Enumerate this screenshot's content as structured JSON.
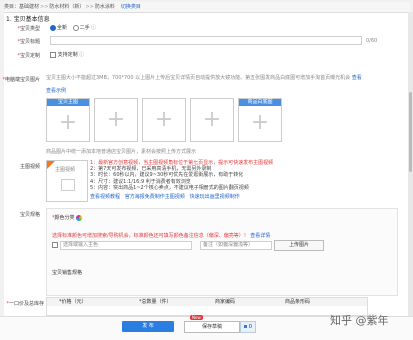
{
  "category": {
    "prefix": "类目：",
    "levels": [
      "基础建材",
      "防水材料（新）",
      "防水涂料"
    ],
    "switch_label": "切换类目"
  },
  "section_title": "1. 宝贝基本信息",
  "type_row": {
    "label": "宝贝类型",
    "options": [
      "全新",
      "二手"
    ],
    "selected": 0
  },
  "title_row": {
    "label": "宝贝标题",
    "counter": "0/60"
  },
  "custom_row": {
    "label": "宝贝定制",
    "option": "支持定制"
  },
  "main_image": {
    "label": "电脑端宝贝图片",
    "hint": "宝贝主图大小不能超过3MB；700*700 以上图片上传后宝贝详情页自动提供放大镜功能。第五张图发商品白底图可增加手淘首页曝光机会",
    "hint_link": "查看",
    "example_link": "查看示例",
    "box_labels": [
      "宝贝主图",
      "",
      "",
      "",
      "商品白底图"
    ],
    "footer_hint": "商品图片中统一添加本地普通店宝贝图片，素材会按照上传方式展示"
  },
  "video": {
    "label": "主图视频",
    "thumb_label": "主图视频",
    "tips": [
      "1：最新官方创意视频，当主图视频角标位于第七页显示，提示可快速发布主图视频",
      "2：第7天可发布视频，已采用高清手机，无需另外录制",
      "3：时长：60秒以内，建议9~30秒可优先在爱逛街展示，有助于转化",
      "4：尺寸：建议1:1/16:9 利于消费者有效浏览",
      "5：内容：突出商品1~2个核心卖点，不建议电子相册式的图片翻页视频"
    ],
    "links": [
      "查看视频教程",
      "官方海报免费制作主图视频",
      "快速玩出画里视频制作"
    ]
  },
  "spec": {
    "label": "宝贝规格",
    "color_title": "颜色分类",
    "color_hint": "选择标准颜色可增加搜索/导购机会，标准颜色还可填写颜色备注信息（偏深、偏亮等）！",
    "color_link": "查看详情",
    "input_placeholder": "选择或输入主色",
    "remark_placeholder": "备注（如偏深偏浅等）",
    "upload_button": "上传图片",
    "spec_table_title": "宝贝销售规格"
  },
  "price_row": {
    "label": "一口价及总库存",
    "columns": [
      "*价格（元）",
      "*总数量（件）",
      "商家编码",
      "商品条形码"
    ]
  },
  "bottom_bar": {
    "publish": "发 布",
    "save_draft": "保存草稿",
    "new_badge": "New",
    "draft_count": "0",
    "watermark": "知乎 @紫年"
  }
}
